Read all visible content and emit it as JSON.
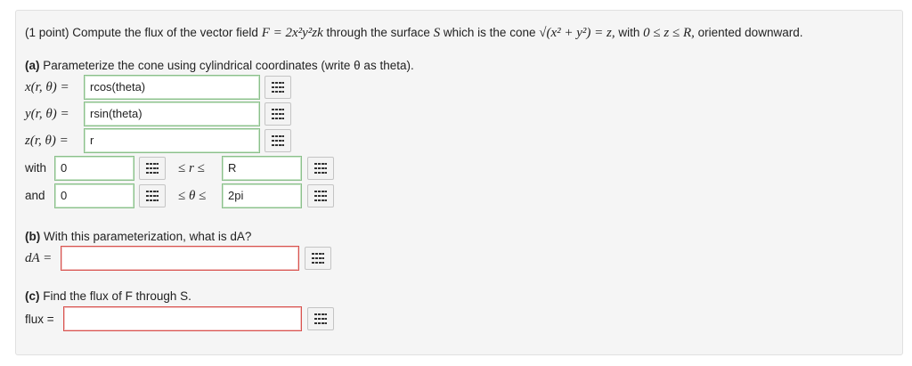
{
  "problem": {
    "points": "(1 point)",
    "text_a": "Compute the flux of the vector field",
    "F_def": "F = 2x²y²zk",
    "text_b": "through the surface",
    "S": "S",
    "text_c": "which is the cone",
    "cone": "√(x² + y²) = z,",
    "text_d": "with",
    "range": "0 ≤ z ≤ R,",
    "text_e": "oriented downward."
  },
  "part_a": {
    "heading_bold": "(a)",
    "heading": "Parameterize the cone using cylindrical coordinates (write θ as theta).",
    "x_label": "x(r, θ) =",
    "x_value": "rcos(theta)",
    "y_label": "y(r, θ) =",
    "y_value": "rsin(theta)",
    "z_label": "z(r, θ) =",
    "z_value": "r",
    "with_label": "with",
    "r_min": "0",
    "r_ineq": "≤ r ≤",
    "r_max": "R",
    "and_label": "and",
    "t_min": "0",
    "t_ineq": "≤ θ ≤",
    "t_max": "2pi"
  },
  "part_b": {
    "heading_bold": "(b)",
    "heading": "With this parameterization, what is dA?",
    "dA_label": "dA =",
    "dA_value": ""
  },
  "part_c": {
    "heading_bold": "(c)",
    "heading": "Find the flux of F through S.",
    "flux_label": "flux =",
    "flux_value": ""
  },
  "icons": {
    "palette": "equation-editor-grid-icon"
  },
  "colors": {
    "correct_border": "#8cc08c",
    "empty_border": "#d9534f",
    "panel_bg": "#f5f5f5"
  }
}
